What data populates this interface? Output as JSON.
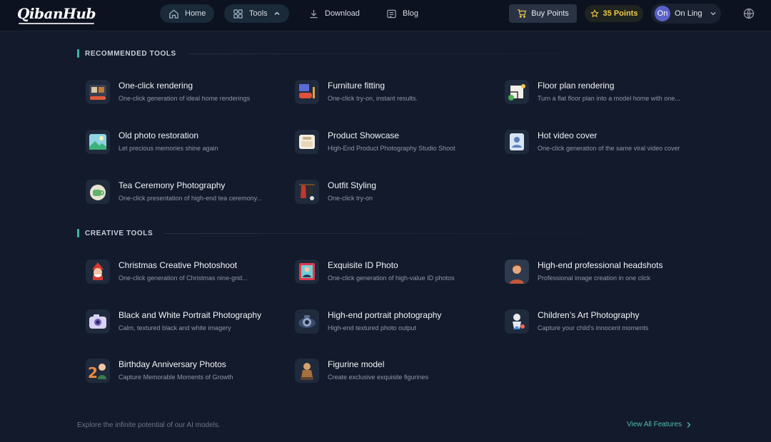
{
  "brand": {
    "logo": "QibanHub"
  },
  "nav": {
    "home": "Home",
    "tools": "Tools",
    "download": "Download",
    "blog": "Blog"
  },
  "account": {
    "buy_points": "Buy Points",
    "points": "35 Points",
    "avatar_initials": "On",
    "user_name": "On Ling"
  },
  "recommended": {
    "title": "RECOMMENDED TOOLS",
    "items": [
      {
        "name": "One-click rendering",
        "desc": "One-click generation of ideal home renderings"
      },
      {
        "name": "Furniture fitting",
        "desc": "One-click try-on, instant results."
      },
      {
        "name": "Floor plan rendering",
        "desc": "Turn a flat floor plan into a model home with one..."
      },
      {
        "name": "Old photo restoration",
        "desc": "Let precious memories shine again"
      },
      {
        "name": "Product Showcase",
        "desc": "High-End Product Photography Studio Shoot"
      },
      {
        "name": "Hot video cover",
        "desc": "One-click generation of the same viral video cover"
      },
      {
        "name": "Tea Ceremony Photography",
        "desc": "One-click presentation of high-end tea ceremony..."
      },
      {
        "name": "Outfit Styling",
        "desc": "One-click try-on"
      }
    ]
  },
  "creative": {
    "title": "CREATIVE TOOLS",
    "items": [
      {
        "name": "Christmas Creative Photoshoot",
        "desc": "One-click generation of Christmas nine-grid..."
      },
      {
        "name": "Exquisite ID Photo",
        "desc": "One-click generation of high-value ID photos"
      },
      {
        "name": "High-end professional headshots",
        "desc": "Professional image creation in one click"
      },
      {
        "name": "Black and White Portrait Photography",
        "desc": "Calm, textured black and white imagery"
      },
      {
        "name": "High-end portrait photography",
        "desc": "High-end textured photo output"
      },
      {
        "name": "Children’s Art Photography",
        "desc": "Capture your child's innocent moments"
      },
      {
        "name": "Birthday Anniversary Photos",
        "desc": "Capture Memorable Moments of Growth"
      },
      {
        "name": "Figurine model",
        "desc": "Create exclusive exquisite figurines"
      }
    ]
  },
  "footer": {
    "tagline": "Explore the infinite potential of our AI models.",
    "view_all": "View All Features"
  },
  "colors": {
    "accent": "#4fbfb2",
    "points": "#f1c94a",
    "avatar": "#5a62c9"
  }
}
